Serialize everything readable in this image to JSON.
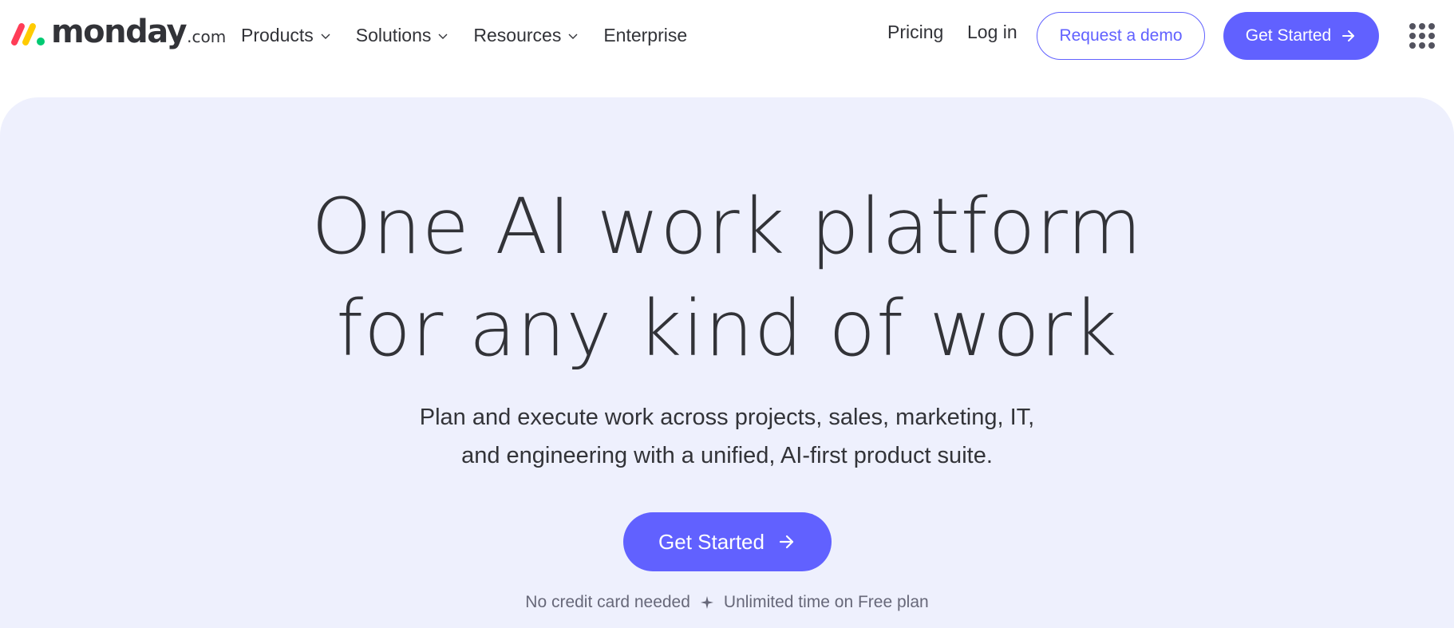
{
  "header": {
    "logo": {
      "wordmark": "monday",
      "tld": ".com",
      "colors": [
        "#ff3d57",
        "#ffcb00",
        "#00ca72"
      ]
    },
    "nav": [
      {
        "label": "Products",
        "has_dropdown": true
      },
      {
        "label": "Solutions",
        "has_dropdown": true
      },
      {
        "label": "Resources",
        "has_dropdown": true
      },
      {
        "label": "Enterprise",
        "has_dropdown": false
      }
    ],
    "pricing_label": "Pricing",
    "login_label": "Log in",
    "demo_label": "Request a demo",
    "get_started_label": "Get Started",
    "apps_icon": "grid-dots-icon"
  },
  "hero": {
    "title_lines": [
      "One AI work platform",
      "for any kind of work"
    ],
    "subtitle_lines": [
      "Plan and execute work across projects, sales, marketing, IT,",
      "and engineering with a unified, AI-first product suite."
    ],
    "cta_label": "Get Started",
    "note_left": "No credit card needed",
    "note_right": "Unlimited time on Free plan",
    "note_separator_icon": "sparkle-icon"
  },
  "colors": {
    "primary": "#6161ff",
    "hero_background": "#eef0fd",
    "text": "#323338",
    "muted_text": "#676879"
  }
}
